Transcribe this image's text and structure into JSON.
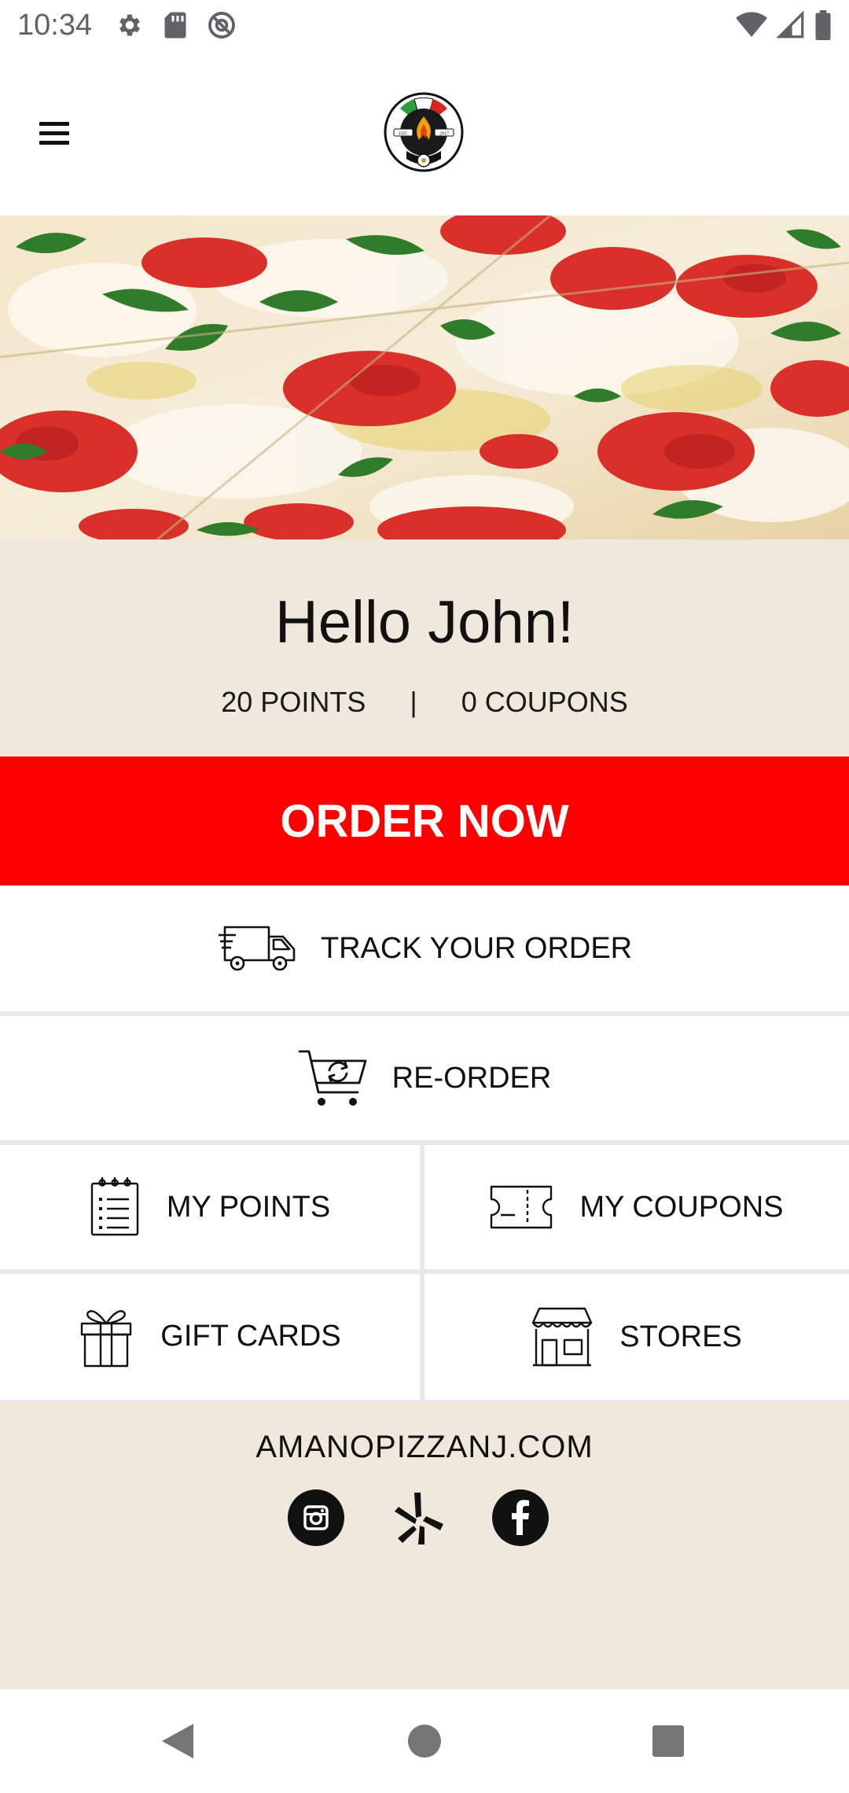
{
  "status_bar": {
    "time": "10:34",
    "left_icons": [
      "settings-icon",
      "sd-card-icon",
      "do-not-disturb-icon"
    ],
    "right_icons": [
      "wifi-icon",
      "cell-signal-icon",
      "battery-icon"
    ]
  },
  "header": {
    "menu_icon": "hamburger-menu-icon",
    "logo": {
      "left_text": "EST.",
      "right_text": "2017"
    }
  },
  "hero": {
    "image": "pizza-photo"
  },
  "greeting": {
    "title": "Hello John!",
    "points": "20 POINTS",
    "separator": "|",
    "coupons": "0 COUPONS"
  },
  "actions": {
    "order_now": "ORDER NOW",
    "track_order": "TRACK YOUR ORDER",
    "reorder": "RE-ORDER",
    "my_points": "MY POINTS",
    "my_coupons": "MY COUPONS",
    "gift_cards": "GIFT CARDS",
    "stores": "STORES"
  },
  "footer": {
    "site": "AMANOPIZZANJ.COM",
    "socials": [
      "instagram-icon",
      "yelp-icon",
      "facebook-icon"
    ]
  },
  "nav_bar": {
    "buttons": [
      "back-icon",
      "home-icon",
      "recents-icon"
    ]
  },
  "colors": {
    "accent_red": "#ff0000",
    "panel_beige": "#f0e8dc",
    "divider_gray": "#e8e8e8"
  }
}
